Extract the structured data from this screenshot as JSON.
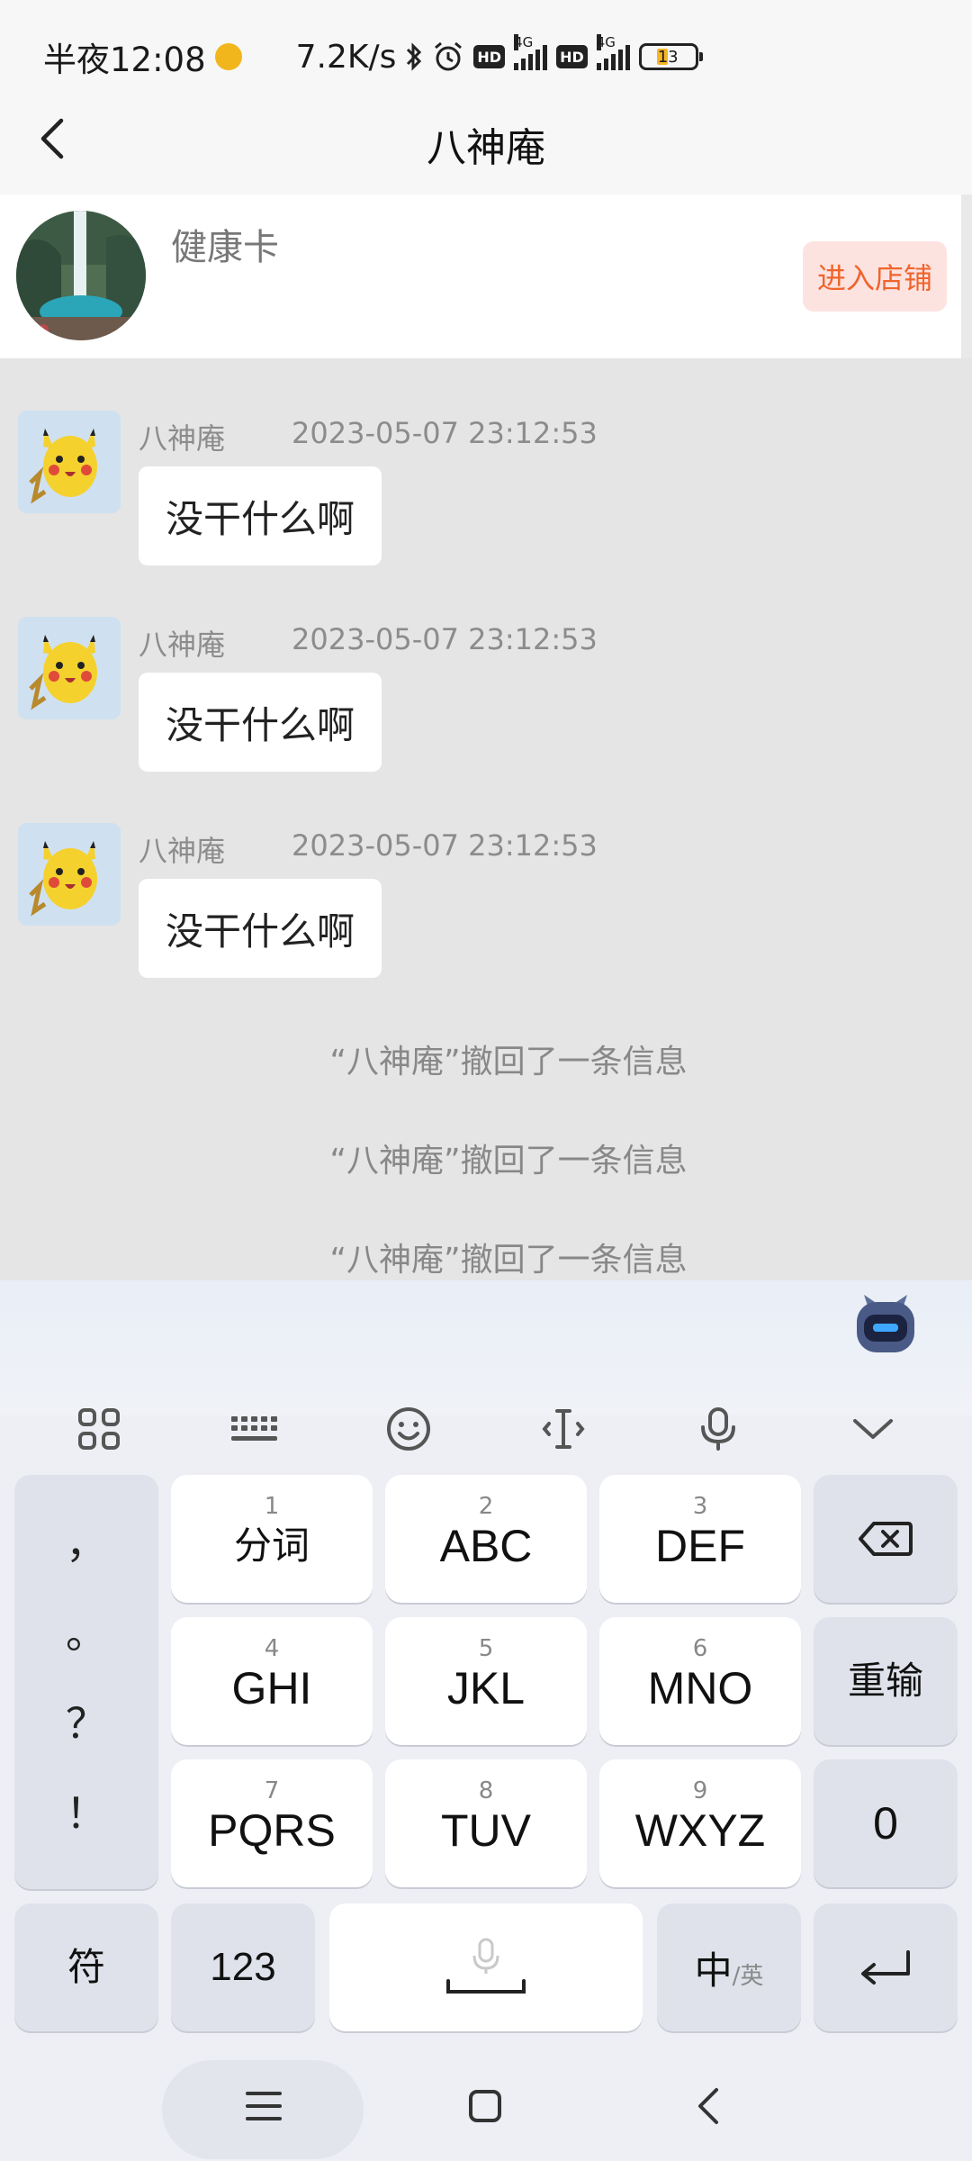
{
  "status_bar": {
    "time": "半夜12:08",
    "network_speed": "7.2K/s",
    "battery_level": "13",
    "icons": [
      "notification-app-icon",
      "bluetooth-icon",
      "alarm-icon",
      "hd-icon",
      "signal-4g-icon",
      "hd-icon",
      "signal-4g-icon",
      "battery-icon"
    ],
    "hd_label": "HD",
    "network_type": "4G"
  },
  "header": {
    "title": "八神庵",
    "back_icon": "chevron-left-icon"
  },
  "store_card": {
    "name": "健康卡",
    "enter_button": "进入店铺",
    "accent_color": "#f0642c"
  },
  "messages": [
    {
      "sender": "八神庵",
      "time": "2023-05-07 23:12:53",
      "text": "没干什么啊"
    },
    {
      "sender": "八神庵",
      "time": "2023-05-07 23:12:53",
      "text": "没干什么啊"
    },
    {
      "sender": "八神庵",
      "time": "2023-05-07 23:12:53",
      "text": "没干什么啊"
    }
  ],
  "recall_notices": [
    "“八神庵”撤回了一条信息",
    "“八神庵”撤回了一条信息",
    "“八神庵”撤回了一条信息"
  ],
  "keyboard": {
    "toolbar_icons": [
      "grid-apps-icon",
      "keyboard-icon",
      "emoji-icon",
      "text-cursor-icon",
      "microphone-icon",
      "collapse-chevron-icon"
    ],
    "assistant_icon": "robot-assistant-icon",
    "punctuation": [
      "，",
      "。",
      "？",
      "！"
    ],
    "keys": [
      {
        "num": "1",
        "label": "分词"
      },
      {
        "num": "2",
        "label": "ABC"
      },
      {
        "num": "3",
        "label": "DEF"
      },
      {
        "num": "4",
        "label": "GHI"
      },
      {
        "num": "5",
        "label": "JKL"
      },
      {
        "num": "6",
        "label": "MNO"
      },
      {
        "num": "7",
        "label": "PQRS"
      },
      {
        "num": "8",
        "label": "TUV"
      },
      {
        "num": "9",
        "label": "WXYZ"
      }
    ],
    "delete_icon": "backspace-icon",
    "reenter": "重输",
    "zero": "0",
    "symbols": "符",
    "numbers": "123",
    "space_icon": "space-mic-icon",
    "lang_main": "中",
    "lang_alt": "/英",
    "enter_icon": "enter-icon"
  },
  "nav_bar": {
    "icons": [
      "menu-icon",
      "home-square-icon",
      "back-triangle-icon"
    ]
  }
}
